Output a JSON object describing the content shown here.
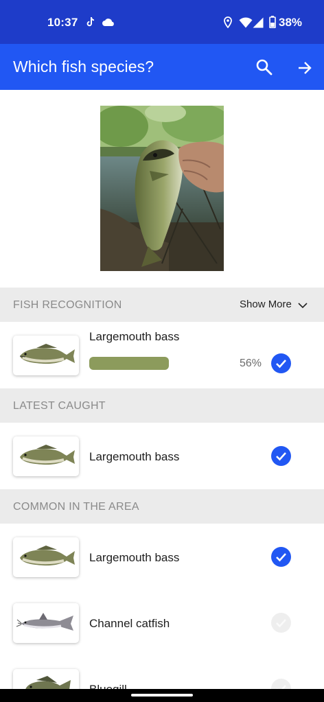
{
  "status_bar": {
    "time": "10:37",
    "battery_pct": "38%",
    "icons": [
      "tiktok-icon",
      "cloud-icon",
      "location-icon",
      "wifi-icon",
      "signal-icon",
      "battery-icon"
    ]
  },
  "app_bar": {
    "title": "Which fish species?",
    "icons": [
      "search-icon",
      "arrow-right-icon"
    ]
  },
  "colors": {
    "status_bar": "#1e3cc9",
    "app_bar": "#2157f3",
    "check_active": "#2157f3",
    "check_inactive": "#eeeeee",
    "progress": "#8c9b5c",
    "section_bg": "#ebebeb"
  },
  "recognition": {
    "header": "FISH RECOGNITION",
    "show_more": "Show More",
    "item": {
      "name": "Largemouth bass",
      "confidence": 0.56,
      "confidence_label": "56%",
      "selected": true
    }
  },
  "latest_caught": {
    "header": "LATEST CAUGHT",
    "items": [
      {
        "name": "Largemouth bass",
        "selected": true
      }
    ]
  },
  "common_in_area": {
    "header": "COMMON IN THE AREA",
    "items": [
      {
        "name": "Largemouth bass",
        "selected": true
      },
      {
        "name": "Channel catfish",
        "selected": false
      },
      {
        "name": "Bluegill",
        "selected": false
      }
    ]
  }
}
